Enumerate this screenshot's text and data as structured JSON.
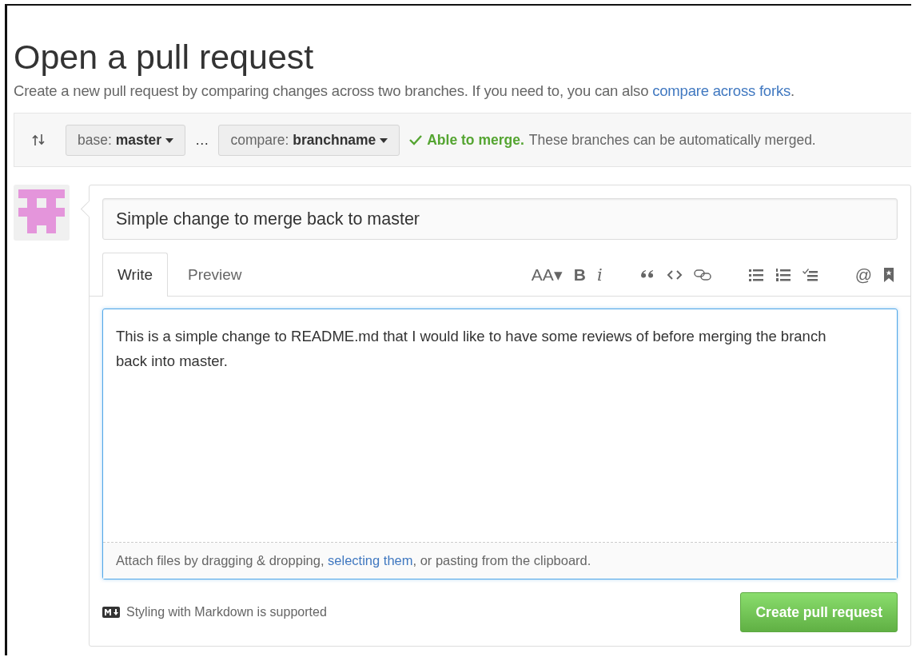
{
  "page": {
    "title": "Open a pull request",
    "subtitle": "Create a new pull request by comparing changes across two branches. If you need to, you can also ",
    "subtitle_link": "compare across forks",
    "subtitle_end": "."
  },
  "compare_bar": {
    "base_label": "base:",
    "base_value": "master",
    "separator": "…",
    "compare_label": "compare:",
    "compare_value": "branchname",
    "merge_ok": true,
    "merge_status": "Able to merge.",
    "merge_note": "These branches can be automatically merged."
  },
  "form": {
    "title_value": "Simple change to merge back to master",
    "tabs": [
      {
        "label": "Write",
        "selected": true
      },
      {
        "label": "Preview",
        "selected": false
      }
    ],
    "toolbar": [
      {
        "kind": "text",
        "label": "AA▾"
      },
      {
        "kind": "text",
        "label": "B",
        "bold": true
      },
      {
        "kind": "text",
        "label": "i"
      },
      {
        "kind": "gap"
      },
      {
        "kind": "quote"
      },
      {
        "kind": "code"
      },
      {
        "kind": "link"
      },
      {
        "kind": "gap"
      },
      {
        "kind": "ul"
      },
      {
        "kind": "ol"
      },
      {
        "kind": "tasks"
      },
      {
        "kind": "gap"
      },
      {
        "kind": "text",
        "label": "@"
      },
      {
        "kind": "bookmark"
      }
    ],
    "body_value": "This is a simple change to README.md that I would like to have some reviews of before merging the branch back into master.",
    "attach_text": "Attach files by dragging & dropping, ",
    "attach_link": "selecting them",
    "attach_end": ", or pasting from the clipboard.",
    "markdown_note": "Styling with Markdown is supported",
    "submit": "Create pull request"
  }
}
